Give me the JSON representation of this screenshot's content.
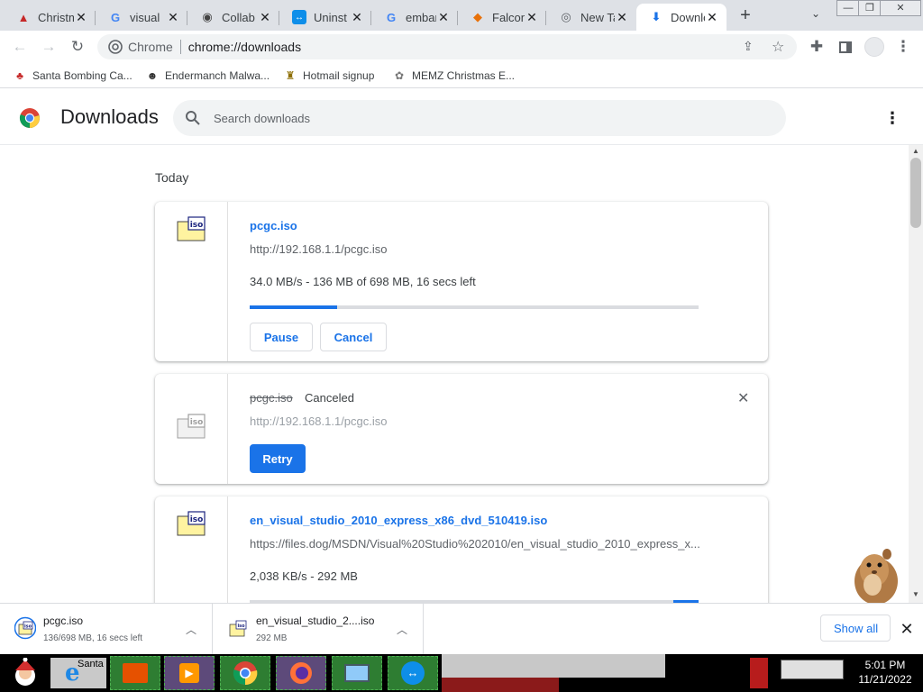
{
  "tabs": [
    {
      "title": "Christmas",
      "icon": "santa-icon"
    },
    {
      "title": "visual",
      "icon": "google-icon"
    },
    {
      "title": "Collab",
      "icon": "collab-icon"
    },
    {
      "title": "Uninst",
      "icon": "teamviewer-icon"
    },
    {
      "title": "embar",
      "icon": "google-icon"
    },
    {
      "title": "Falcon",
      "icon": "falcon-icon"
    },
    {
      "title": "New Tab",
      "icon": "chrome-icon"
    },
    {
      "title": "Downloads",
      "icon": "download-icon",
      "active": true
    }
  ],
  "window_controls": {
    "minimize": "—",
    "maximize": "❐",
    "close": "✕"
  },
  "omnibox": {
    "site": "Chrome",
    "url": "chrome://downloads"
  },
  "bookmarks": [
    {
      "label": "Santa Bombing Ca...",
      "icon": "santa-icon"
    },
    {
      "label": "Endermanch Malwa...",
      "icon": "malware-icon"
    },
    {
      "label": "Hotmail signup",
      "icon": "hotmail-icon"
    },
    {
      "label": "MEMZ Christmas E...",
      "icon": "memz-icon"
    }
  ],
  "page": {
    "title": "Downloads",
    "search_placeholder": "Search downloads",
    "section": "Today"
  },
  "downloads": [
    {
      "name": "pcgc.iso",
      "url": "http://192.168.1.1/pcgc.iso",
      "status": "34.0 MB/s - 136 MB of 698 MB, 16 secs left",
      "progress": 0.195,
      "buttons": [
        "Pause",
        "Cancel"
      ]
    },
    {
      "name": "pcgc.iso",
      "tag": "Canceled",
      "url": "http://192.168.1.1/pcgc.iso",
      "buttons": [
        "Retry"
      ]
    },
    {
      "name": "en_visual_studio_2010_express_x86_dvd_510419.iso",
      "url": "https://files.dog/MSDN/Visual%20Studio%202010/en_visual_studio_2010_express_x...",
      "status": "2,038 KB/s - 292 MB",
      "progress": "indeterminate"
    }
  ],
  "shelf": {
    "items": [
      {
        "name": "pcgc.iso",
        "status": "136/698 MB, 16 secs left"
      },
      {
        "name": "en_visual_studio_2....iso",
        "status": "292 MB"
      }
    ],
    "show_all": "Show all"
  },
  "taskbar": {
    "start_label": "Santa",
    "time": "5:01 PM",
    "date": "11/21/2022"
  },
  "colors": {
    "accent": "#1a73e8",
    "tabstrip": "#dee1e6"
  }
}
